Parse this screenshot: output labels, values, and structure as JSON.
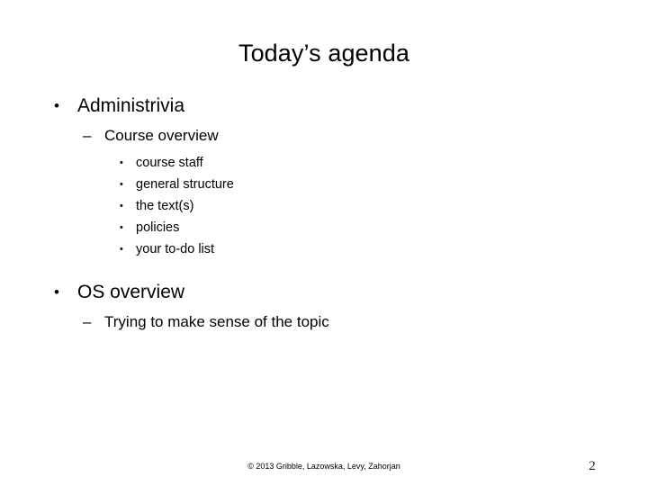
{
  "slide": {
    "title": "Today’s agenda",
    "outline": [
      {
        "level": 1,
        "marker": "•",
        "text": "Administrivia"
      },
      {
        "level": 2,
        "marker": "–",
        "text": "Course overview"
      },
      {
        "level": 3,
        "marker": "•",
        "text": "course staff"
      },
      {
        "level": 3,
        "marker": "•",
        "text": "general structure"
      },
      {
        "level": 3,
        "marker": "•",
        "text": "the text(s)"
      },
      {
        "level": 3,
        "marker": "•",
        "text": "policies"
      },
      {
        "level": 3,
        "marker": "•",
        "text": "your to-do list"
      },
      {
        "level": 1,
        "marker": "•",
        "text": "OS overview"
      },
      {
        "level": 2,
        "marker": "–",
        "text": "Trying to make sense of the topic"
      }
    ],
    "footer": {
      "credit": "© 2013 Gribble, Lazowska, Levy, Zahorjan",
      "page_number": "2"
    }
  },
  "colors": {
    "background": "#ffffff",
    "text": "#000000",
    "page_number": "#1a1a1a"
  }
}
